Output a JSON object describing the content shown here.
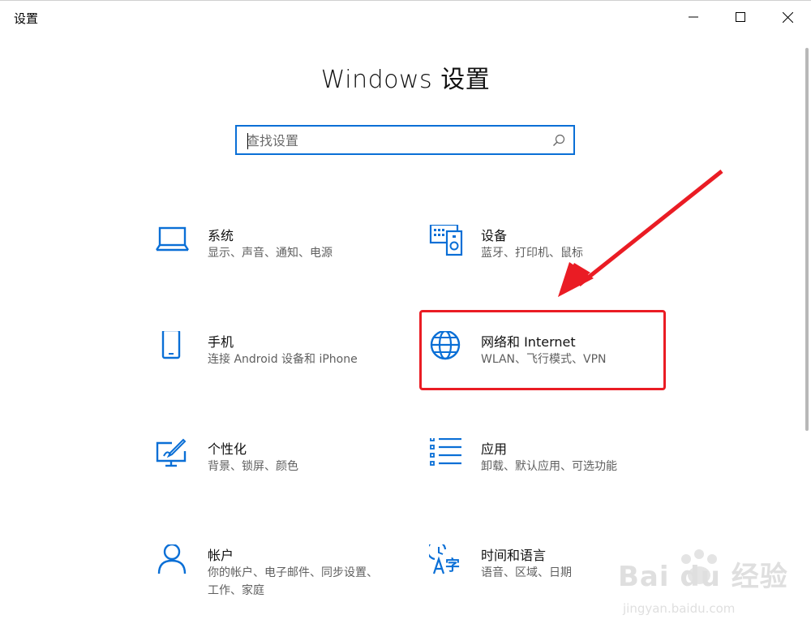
{
  "window": {
    "title": "设置",
    "controls": {
      "minimize": "minimize",
      "maximize": "maximize",
      "close": "close"
    }
  },
  "header": {
    "title": "Windows 设置"
  },
  "search": {
    "placeholder": "查找设置",
    "value": ""
  },
  "tiles": [
    {
      "name": "系统",
      "desc": "显示、声音、通知、电源",
      "icon": "laptop-icon"
    },
    {
      "name": "设备",
      "desc": "蓝牙、打印机、鼠标",
      "icon": "devices-icon"
    },
    {
      "name": "手机",
      "desc": "连接 Android 设备和 iPhone",
      "icon": "phone-icon"
    },
    {
      "name": "网络和 Internet",
      "desc": "WLAN、飞行模式、VPN",
      "icon": "globe-icon"
    },
    {
      "name": "个性化",
      "desc": "背景、锁屏、颜色",
      "icon": "personalization-icon"
    },
    {
      "name": "应用",
      "desc": "卸载、默认应用、可选功能",
      "icon": "apps-list-icon"
    },
    {
      "name": "帐户",
      "desc": "你的帐户、电子邮件、同步设置、工作、家庭",
      "icon": "person-icon"
    },
    {
      "name": "时间和语言",
      "desc": "语音、区域、日期",
      "icon": "time-language-icon"
    }
  ],
  "annotation": {
    "highlight_color": "#ea1c24",
    "highlighted_tile": "网络和 Internet"
  },
  "watermark": {
    "brand": "Bai du 经验",
    "url": "jingyan.baidu.com"
  },
  "colors": {
    "accent": "#0a6fd6",
    "text": "#111111",
    "subtext": "#5f5f5f"
  }
}
